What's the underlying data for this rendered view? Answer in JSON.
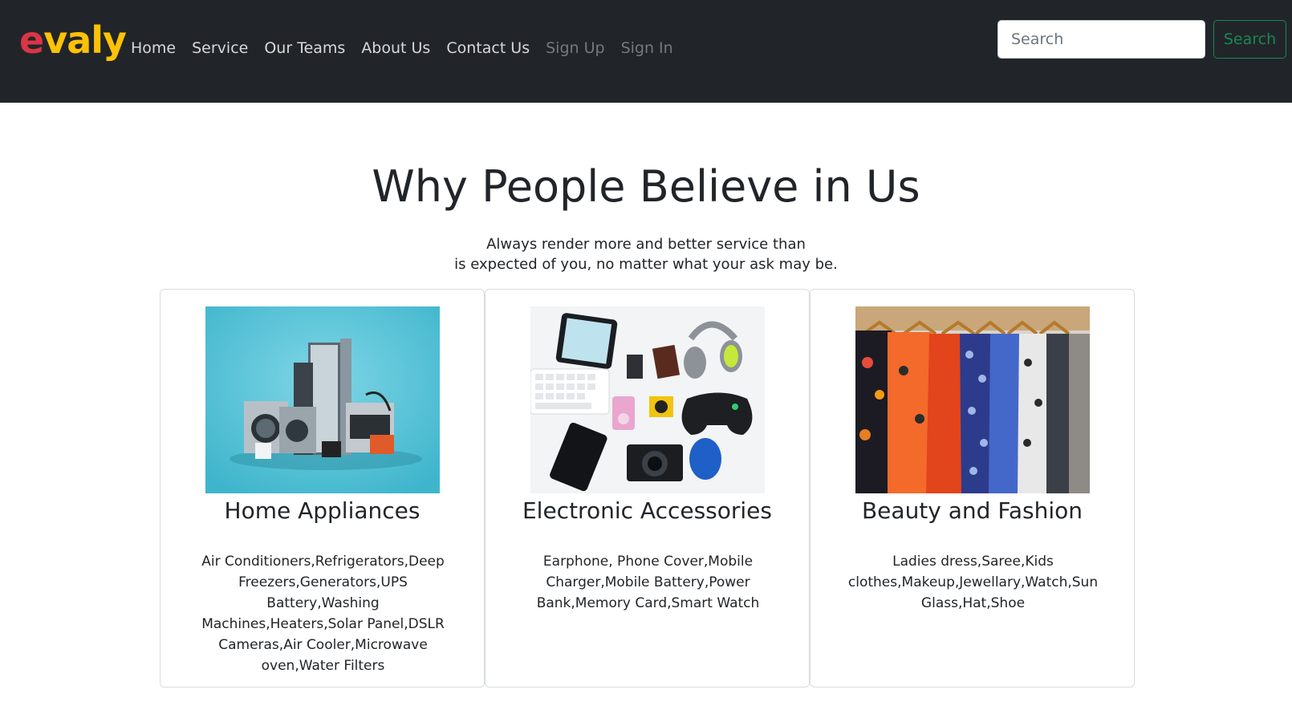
{
  "brand": {
    "first": "e",
    "rest": "valy"
  },
  "nav": {
    "items": [
      {
        "label": "Home"
      },
      {
        "label": "Service"
      },
      {
        "label": "Our Teams"
      },
      {
        "label": "About Us"
      },
      {
        "label": "Contact Us"
      },
      {
        "label": "Sign Up"
      },
      {
        "label": "Sign In"
      }
    ]
  },
  "search": {
    "placeholder": "Search",
    "button_label": "Search"
  },
  "hero": {
    "title": "Why People Believe in Us",
    "subtitle_line1": "Always render more and better service than",
    "subtitle_line2": "is expected of you, no matter what your ask may be."
  },
  "cards": [
    {
      "title": "Home Appliances",
      "text": "Air Conditioners,Refrigerators,Deep Freezers,Generators,UPS Battery,Washing Machines,Heaters,Solar Panel,DSLR Cameras,Air Cooler,Microwave oven,Water Filters"
    },
    {
      "title": "Electronic Accessories",
      "text": "Earphone, Phone Cover,Mobile Charger,Mobile Battery,Power Bank,Memory Card,Smart Watch"
    },
    {
      "title": "Beauty and Fashion",
      "text": "Ladies dress,Saree,Kids clothes,Makeup,Jewellary,Watch,Sun Glass,Hat,Shoe"
    }
  ],
  "colors": {
    "navbar_bg": "#212529",
    "brand_e": "#dc3545",
    "brand_rest": "#ffc107",
    "search_button": "#198754"
  }
}
